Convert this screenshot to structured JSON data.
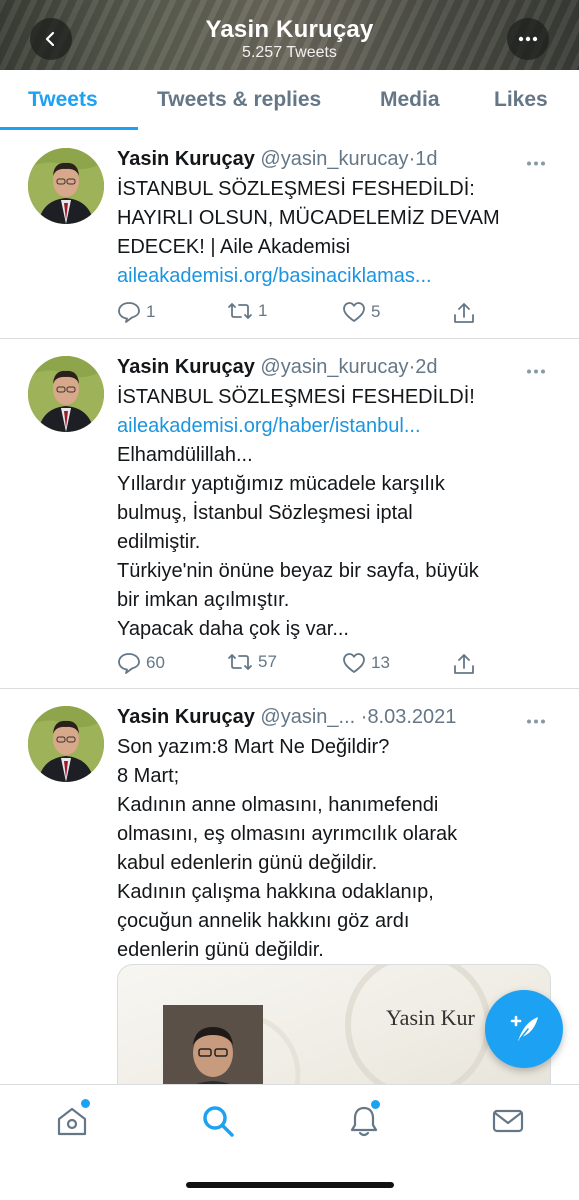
{
  "header": {
    "title": "Yasin Kuruçay",
    "subtitle": "5.257 Tweets"
  },
  "tabs": [
    {
      "label": "Tweets",
      "active": true
    },
    {
      "label": "Tweets & replies",
      "active": false
    },
    {
      "label": "Media",
      "active": false
    },
    {
      "label": "Likes",
      "active": false
    }
  ],
  "tweets": [
    {
      "name": "Yasin Kuruçay",
      "handle": "@yasin_kurucay",
      "time": "1d",
      "lines": [
        "İSTANBUL SÖZLEŞMESİ FESHEDİLDİ:",
        "HAYIRLI OLSUN, MÜCADELEMİZ DEVAM",
        "EDECEK! | Aile Akademisi"
      ],
      "link": "aileakademisi.org/basinaciklamas...",
      "replies": "1",
      "retweets": "1",
      "likes": "5"
    },
    {
      "name": "Yasin Kuruçay",
      "handle": "@yasin_kurucay",
      "time": "2d",
      "line_top": "İSTANBUL SÖZLEŞMESİ FESHEDİLDİ!",
      "link": "aileakademisi.org/haber/istanbul...",
      "lines": [
        "Elhamdülillah...",
        "Yıllardır yaptığımız mücadele karşılık",
        "bulmuş, İstanbul Sözleşmesi iptal",
        "edilmiştir.",
        "Türkiye'nin önüne beyaz bir sayfa, büyük",
        "bir imkan açılmıştır.",
        "Yapacak daha çok iş var..."
      ],
      "replies": "60",
      "retweets": "57",
      "likes": "13"
    },
    {
      "name": "Yasin Kuruçay",
      "handle": "@yasin_...",
      "time": "8.03.2021",
      "lines": [
        "Son yazım:8 Mart Ne Değildir?",
        "8 Mart;",
        "Kadının anne olmasını, hanımefendi",
        "olmasını, eş olmasını ayrımcılık olarak",
        "kabul edenlerin günü değildir.",
        "Kadının çalışma hakkına odaklanıp,",
        "çocuğun annelik hakkını göz ardı",
        "edenlerin günü değildir."
      ],
      "card_name": "Yasin Kur"
    }
  ],
  "colors": {
    "accent": "#1da1f2",
    "link": "#1b95e0",
    "muted": "#657786"
  }
}
